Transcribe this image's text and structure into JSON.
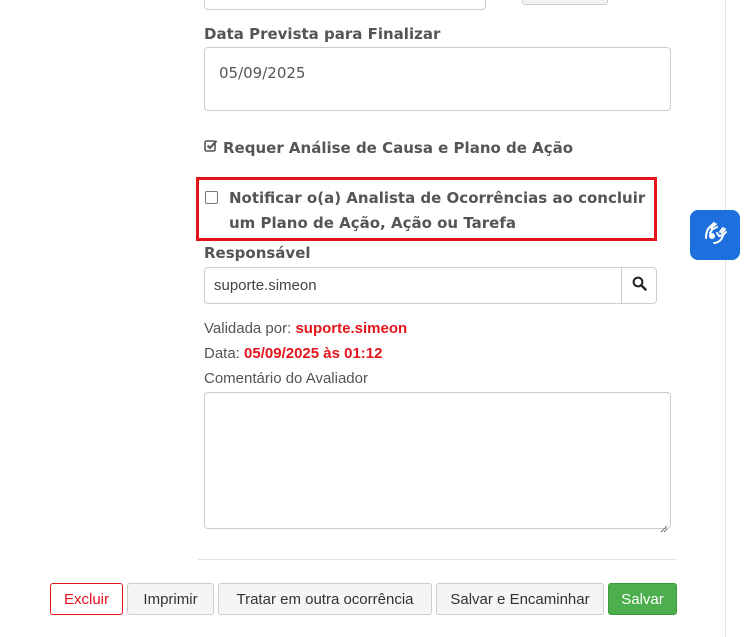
{
  "form": {
    "date_label": "Data Prevista para Finalizar",
    "date_value": "05/09/2025",
    "requires_analysis_label": "Requer Análise de Causa e Plano de Ação",
    "notify_label": "Notificar o(a) Analista de Ocorrências ao concluir um Plano de Ação, Ação ou Tarefa",
    "responsible_label": "Responsável",
    "responsible_value": "suporte.simeon",
    "validated_by_label": "Validada por:",
    "validated_by_value": "suporte.simeon",
    "date_line_label": "Data:",
    "date_line_value": "05/09/2025 às 01:12",
    "comment_label": "Comentário do Avaliador",
    "comment_value": ""
  },
  "buttons": {
    "delete": "Excluir",
    "print": "Imprimir",
    "handle_other": "Tratar em outra ocorrência",
    "save_forward": "Salvar e Encaminhar",
    "save": "Salvar"
  },
  "icons": {
    "requires_analysis": "check-square-icon",
    "search": "search-icon",
    "accessibility": "sign-language-icon"
  },
  "colors": {
    "highlight_border": "#e3141b",
    "validated_text": "#e3141b",
    "save_button": "#4cae4c",
    "accessibility_widget": "#1c6fdc"
  }
}
